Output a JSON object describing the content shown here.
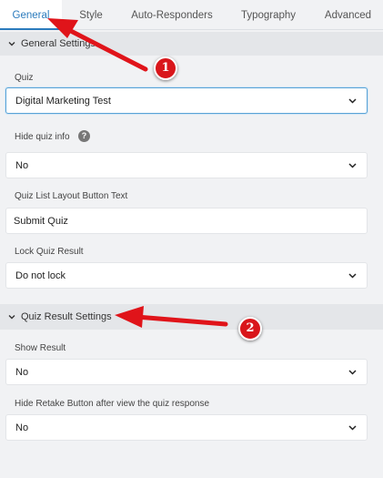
{
  "tabs": [
    {
      "label": "General",
      "active": true
    },
    {
      "label": "Style",
      "active": false
    },
    {
      "label": "Auto-Responders",
      "active": false
    },
    {
      "label": "Typography",
      "active": false
    },
    {
      "label": "Advanced",
      "active": false
    }
  ],
  "general_settings": {
    "title": "General Settings",
    "quiz": {
      "label": "Quiz",
      "value": "Digital Marketing Test"
    },
    "hide_quiz_info": {
      "label": "Hide quiz info",
      "value": "No",
      "help_icon": "question-circle-icon"
    },
    "button_text": {
      "label": "Quiz List Layout Button Text",
      "value": "Submit Quiz"
    },
    "lock_result": {
      "label": "Lock Quiz Result",
      "value": "Do not lock"
    }
  },
  "quiz_result_settings": {
    "title": "Quiz Result Settings",
    "show_result": {
      "label": "Show Result",
      "value": "No"
    },
    "hide_retake": {
      "label": "Hide Retake Button after view the quiz response",
      "value": "No"
    }
  },
  "annotations": {
    "badge_1": "1",
    "badge_2": "2",
    "color": "#d9161b"
  },
  "colors": {
    "accent": "#2b7bbd",
    "background": "#f1f2f4",
    "section_header": "#e4e6e9"
  }
}
